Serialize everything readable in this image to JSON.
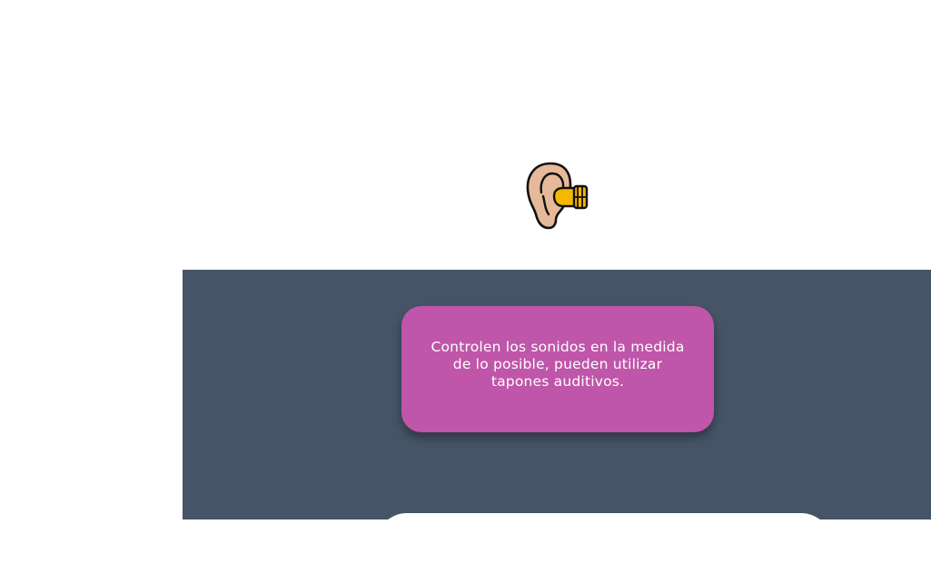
{
  "illustration": {
    "icon": "ear-with-earplug-icon"
  },
  "tip": {
    "text": "Controlen los sonidos en la medida de lo posible, pueden utilizar tapones auditivos."
  },
  "colors": {
    "panel": "#465467",
    "tip_card": "#bf56a9",
    "ear_skin": "#e6b99a",
    "earplug": "#f5b800",
    "background": "#ffffff"
  }
}
